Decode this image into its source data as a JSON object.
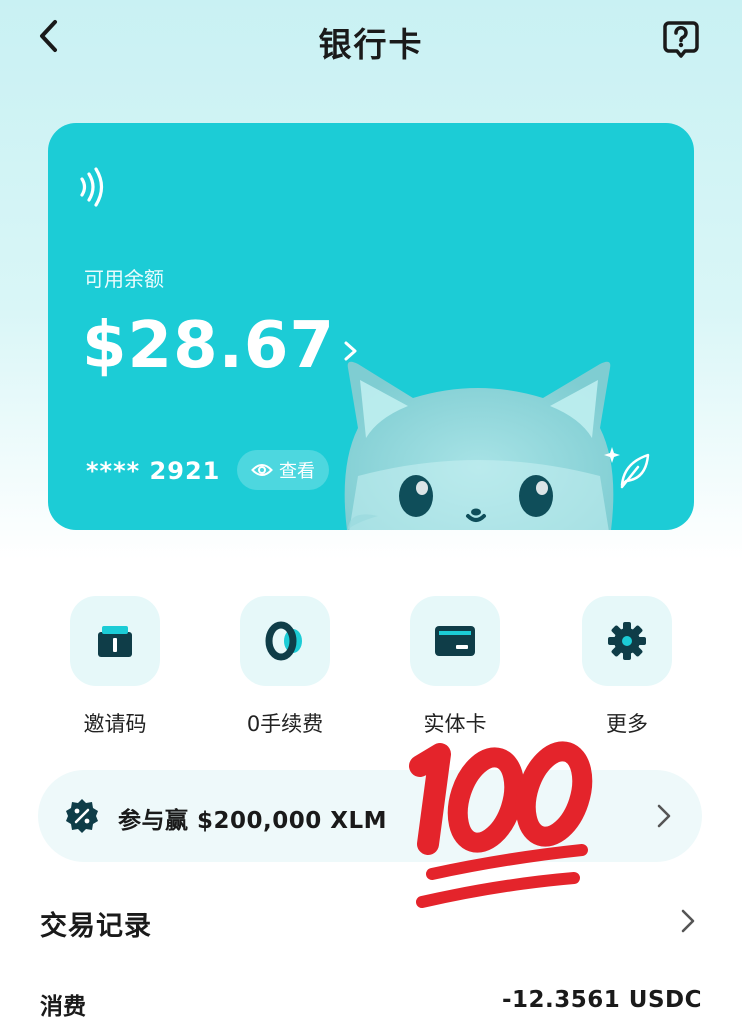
{
  "header": {
    "title": "银行卡"
  },
  "card": {
    "balance_label": "可用余额",
    "balance": "$28.67",
    "card_number": "**** 2921",
    "view_label": "查看"
  },
  "quick_actions": [
    {
      "label": "邀请码",
      "icon": "gift-icon"
    },
    {
      "label": "0手续费",
      "icon": "zero-fee-icon"
    },
    {
      "label": "实体卡",
      "icon": "card-icon"
    },
    {
      "label": "更多",
      "icon": "gear-icon"
    }
  ],
  "promo": {
    "text": "参与赢 $200,000 XLM"
  },
  "transactions": {
    "title": "交易记录",
    "items": [
      {
        "type": "消费",
        "amount": "-12.3561 USDC"
      }
    ]
  },
  "colors": {
    "card": "#1cccd6",
    "accent_red": "#e4242b",
    "tile_bg": "#e6f8f9"
  }
}
